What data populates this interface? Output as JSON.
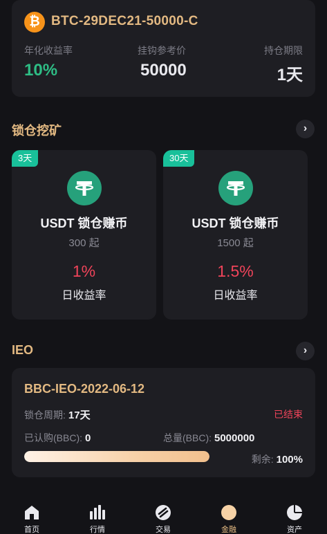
{
  "option": {
    "icon": "bitcoin-icon",
    "name": "BTC-29DEC21-50000-C",
    "stats": [
      {
        "label": "年化收益率",
        "value": "10%"
      },
      {
        "label": "挂钩参考价",
        "value": "50000"
      },
      {
        "label": "持仓期限",
        "value": "1天"
      }
    ]
  },
  "mining": {
    "title": "锁仓挖矿",
    "arrow": "›",
    "cards": [
      {
        "badge": "3天",
        "icon": "tether-icon",
        "title": "USDT 锁仓赚币",
        "min": "300 起",
        "rate": "1%",
        "rate_label": "日收益率"
      },
      {
        "badge": "30天",
        "icon": "tether-icon",
        "title": "USDT 锁仓赚币",
        "min": "1500 起",
        "rate": "1.5%",
        "rate_label": "日收益率"
      }
    ]
  },
  "ieo": {
    "title": "IEO",
    "arrow": "›",
    "name": "BBC-IEO-2022-06-12",
    "period_label": "锁仓周期:",
    "period_value": "17天",
    "status": "已结束",
    "subscribed_label": "已认购(BBC):",
    "subscribed_value": "0",
    "total_label": "总量(BBC):",
    "total_value": "5000000",
    "remaining_label": "剩余:",
    "remaining_value": "100%",
    "progress_percent": 100
  },
  "tabbar": {
    "items": [
      {
        "label": "首页",
        "icon": "home-icon"
      },
      {
        "label": "行情",
        "icon": "bar-chart-icon"
      },
      {
        "label": "交易",
        "icon": "exchange-icon"
      },
      {
        "label": "金融",
        "icon": "finance-icon"
      },
      {
        "label": "资产",
        "icon": "pie-chart-icon"
      }
    ],
    "active_index": 3
  },
  "colors": {
    "background": "#131317",
    "card": "#1e1e23",
    "gold": "#e3b982",
    "green": "#2ebd85",
    "red": "#f0445a",
    "badge": "#19c09a"
  }
}
